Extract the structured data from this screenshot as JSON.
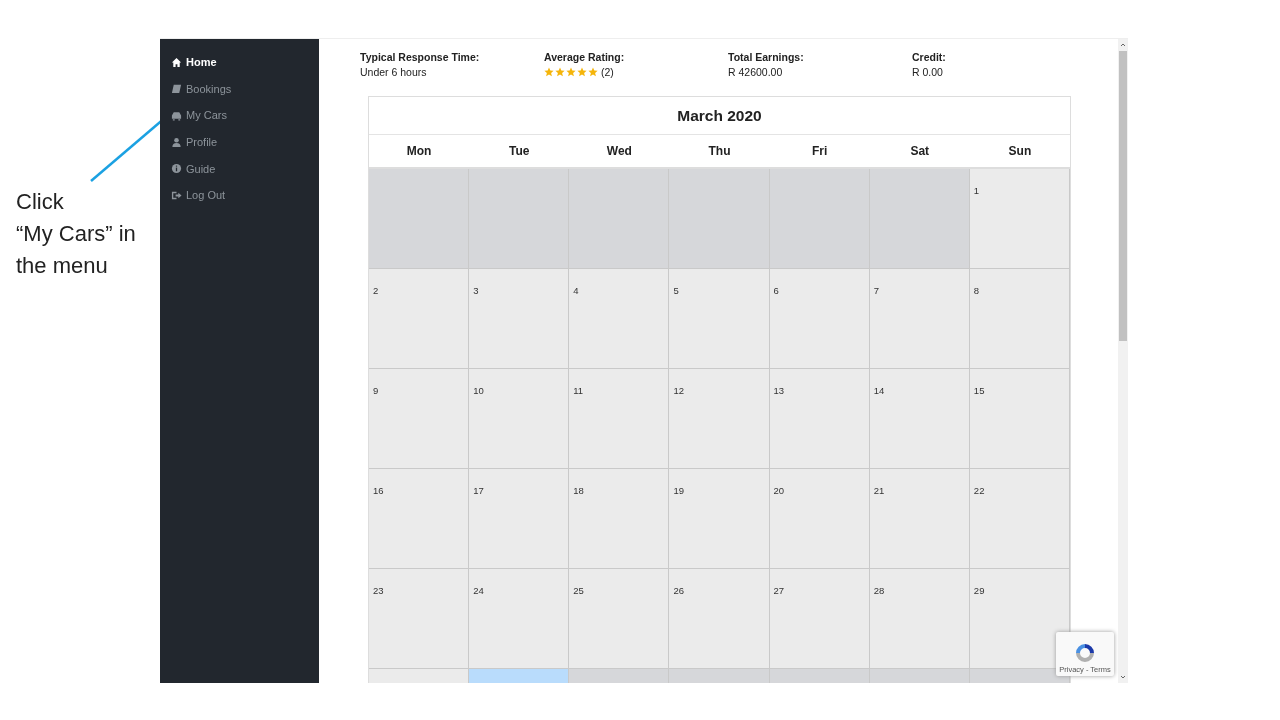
{
  "annotation": {
    "text": "Click\n“My Cars” in\nthe menu"
  },
  "sidebar": {
    "items": [
      {
        "label": "Home",
        "selected": true
      },
      {
        "label": "Bookings",
        "selected": false
      },
      {
        "label": "My Cars",
        "selected": false
      },
      {
        "label": "Profile",
        "selected": false
      },
      {
        "label": "Guide",
        "selected": false
      },
      {
        "label": "Log Out",
        "selected": false
      }
    ]
  },
  "stats": [
    {
      "kind": "text",
      "label": "Typical Response Time:",
      "value": "Under 6 hours"
    },
    {
      "kind": "rating",
      "label": "Average Rating:",
      "stars": 5,
      "count": "(2)"
    },
    {
      "kind": "text",
      "label": "Total Earnings:",
      "value": "R 42600.00"
    },
    {
      "kind": "text",
      "label": "Credit:",
      "value": "R 0.00"
    }
  ],
  "calendar": {
    "title": "March 2020",
    "weekdays": [
      "Mon",
      "Tue",
      "Wed",
      "Thu",
      "Fri",
      "Sat",
      "Sun"
    ],
    "weeks": [
      [
        {
          "kind": "out"
        },
        {
          "kind": "out"
        },
        {
          "kind": "out"
        },
        {
          "kind": "out"
        },
        {
          "kind": "out"
        },
        {
          "kind": "out"
        },
        {
          "kind": "in",
          "day": "1"
        }
      ],
      [
        {
          "kind": "in",
          "day": "2"
        },
        {
          "kind": "in",
          "day": "3"
        },
        {
          "kind": "in",
          "day": "4"
        },
        {
          "kind": "in",
          "day": "5"
        },
        {
          "kind": "in",
          "day": "6"
        },
        {
          "kind": "in",
          "day": "7"
        },
        {
          "kind": "in",
          "day": "8"
        }
      ],
      [
        {
          "kind": "in",
          "day": "9"
        },
        {
          "kind": "in",
          "day": "10"
        },
        {
          "kind": "in",
          "day": "11"
        },
        {
          "kind": "in",
          "day": "12"
        },
        {
          "kind": "in",
          "day": "13"
        },
        {
          "kind": "in",
          "day": "14"
        },
        {
          "kind": "in",
          "day": "15"
        }
      ],
      [
        {
          "kind": "in",
          "day": "16"
        },
        {
          "kind": "in",
          "day": "17"
        },
        {
          "kind": "in",
          "day": "18"
        },
        {
          "kind": "in",
          "day": "19"
        },
        {
          "kind": "in",
          "day": "20"
        },
        {
          "kind": "in",
          "day": "21"
        },
        {
          "kind": "in",
          "day": "22"
        }
      ],
      [
        {
          "kind": "in",
          "day": "23"
        },
        {
          "kind": "in",
          "day": "24"
        },
        {
          "kind": "in",
          "day": "25"
        },
        {
          "kind": "in",
          "day": "26"
        },
        {
          "kind": "in",
          "day": "27"
        },
        {
          "kind": "in",
          "day": "28"
        },
        {
          "kind": "in",
          "day": "29"
        }
      ],
      [
        {
          "kind": "in"
        },
        {
          "kind": "today"
        },
        {
          "kind": "out"
        },
        {
          "kind": "out"
        },
        {
          "kind": "out"
        },
        {
          "kind": "out"
        },
        {
          "kind": "out"
        }
      ]
    ]
  },
  "recaptcha": {
    "text": "Privacy - Terms"
  }
}
